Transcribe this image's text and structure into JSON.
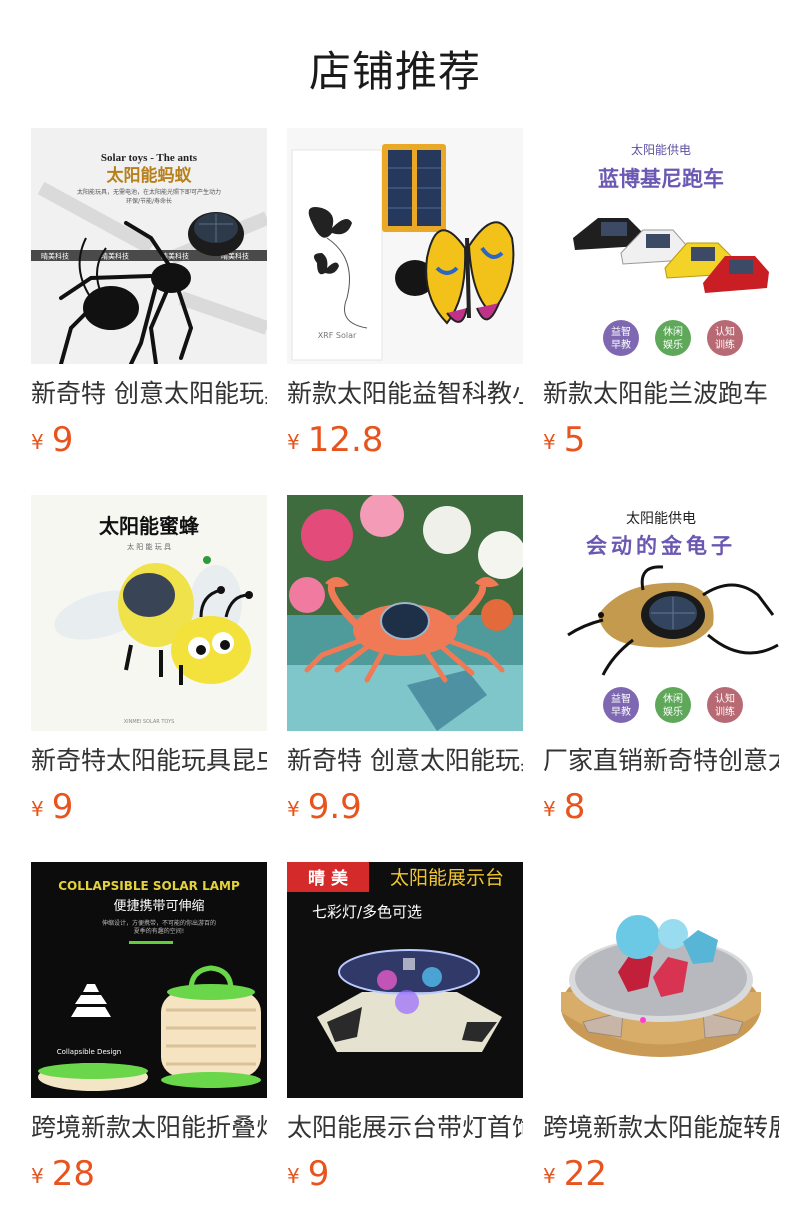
{
  "header": {
    "title": "店铺推荐"
  },
  "products": [
    {
      "name": "新奇特 创意太阳能玩具",
      "currency": "¥",
      "price": "9",
      "thumb": {
        "title": "Solar toys - The ants",
        "subtitle": "太阳能蚂蚁",
        "caption": "太阳能玩具，无需电池，在太阳能光照下即可产生动力",
        "caption2": "环保/节能/寿命长",
        "brand": "晴美科技",
        "icon": "ant-icon"
      }
    },
    {
      "name": "新款太阳能益智科教小蝴蝶",
      "currency": "¥",
      "price": "12.8",
      "thumb": {
        "box_label": "XRF Solar",
        "icon": "butterfly-icon"
      }
    },
    {
      "name": "新款太阳能兰波跑车",
      "currency": "¥",
      "price": "5",
      "thumb": {
        "top": "太阳能供电",
        "title": "蓝博基尼跑车",
        "badges": [
          "益智\n早教",
          "休闲\n娱乐",
          "认知\n训练"
        ],
        "icon": "race-car-icon"
      }
    },
    {
      "name": "新奇特太阳能玩具昆虫蜜蜂",
      "currency": "¥",
      "price": "9",
      "thumb": {
        "title": "太阳能蜜蜂",
        "subtitle": "太 阳 能 玩 具",
        "footer": "XINMEI SOLAR TOYS",
        "icon": "bee-icon"
      }
    },
    {
      "name": "新奇特 创意太阳能玩具螃蟹",
      "currency": "¥",
      "price": "9.9",
      "thumb": {
        "icon": "crab-icon"
      }
    },
    {
      "name": "厂家直销新奇特创意太阳能",
      "currency": "¥",
      "price": "8",
      "thumb": {
        "top": "太阳能供电",
        "title": "会动的金龟子",
        "badges": [
          "益智\n早教",
          "休闲\n娱乐",
          "认知\n训练"
        ],
        "icon": "beetle-icon"
      }
    },
    {
      "name": "跨境新款太阳能折叠灯笼",
      "currency": "¥",
      "price": "28",
      "thumb": {
        "title": "COLLAPSIBLE SOLAR LAMP",
        "subtitle": "便捷携带可伸缩",
        "caption": "伸缩设计，方便携带，不可能的你出游百的",
        "caption2": "夏季的有趣的空间!",
        "small": "Collapsible Design",
        "icon": "lantern-icon"
      }
    },
    {
      "name": "太阳能展示台带灯首饰",
      "currency": "¥",
      "price": "9",
      "thumb": {
        "brand": "晴 美",
        "title": "太阳能展示台",
        "subtitle": "七彩灯/多色可选",
        "icon": "turntable-icon"
      }
    },
    {
      "name": "跨境新款太阳能旋转展示台",
      "currency": "¥",
      "price": "22",
      "thumb": {
        "icon": "gem-display-icon"
      }
    }
  ]
}
